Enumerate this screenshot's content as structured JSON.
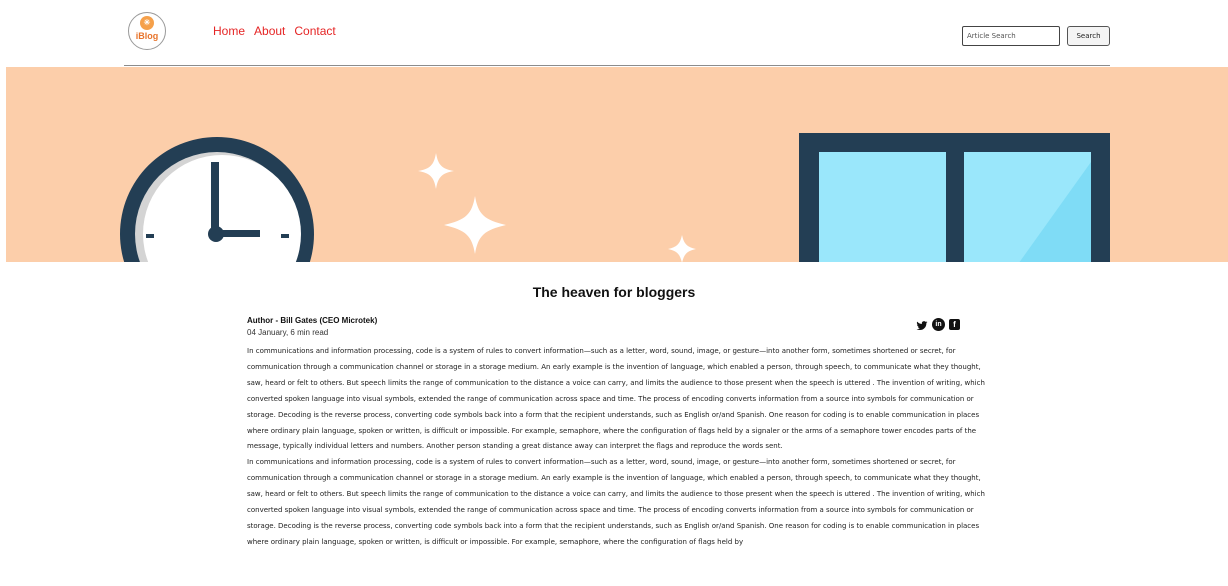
{
  "header": {
    "logo_text": "iBlog",
    "nav": [
      "Home",
      "About",
      "Contact"
    ],
    "search_placeholder": "Article Search",
    "search_button": "Search"
  },
  "hero": {
    "colors": {
      "background": "#fcceaa",
      "dark": "#233e54",
      "glass": "#9ae7fb"
    }
  },
  "article": {
    "title": "The heaven for bloggers",
    "author": "Author - Bill Gates (CEO Microtek)",
    "meta": "04 January, 6 min read",
    "social_icons": [
      "twitter-icon",
      "linkedin-icon",
      "facebook-icon"
    ],
    "paragraphs": [
      "In communications and information processing, code is a system of rules to convert information—such as a letter, word, sound, image, or gesture—into another form, sometimes shortened or secret, for communication through a communication channel or storage in a storage medium. An early example is the invention of language, which enabled a person, through speech, to communicate what they thought, saw, heard or felt to others. But speech limits the range of communication to the distance a voice can carry, and limits the audience to those present when the speech is uttered . The invention of writing, which converted spoken language into visual symbols, extended the range of communication across space and time. The process of encoding converts information from a source into symbols for communication or storage. Decoding is the reverse process, converting code symbols back into a form that the recipient understands, such as English or/and Spanish. One reason for coding is to enable communication in places where ordinary plain language, spoken or written, is difficult or impossible. For example, semaphore, where the configuration of flags held by a signaler or the arms of a semaphore tower encodes parts of the message, typically individual letters and numbers. Another person standing a great distance away can interpret the flags and reproduce the words sent.",
      "In communications and information processing, code is a system of rules to convert information—such as a letter, word, sound, image, or gesture—into another form, sometimes shortened or secret, for communication through a communication channel or storage in a storage medium. An early example is the invention of language, which enabled a person, through speech, to communicate what they thought, saw, heard or felt to others. But speech limits the range of communication to the distance a voice can carry, and limits the audience to those present when the speech is uttered . The invention of writing, which converted spoken language into visual symbols, extended the range of communication across space and time. The process of encoding converts information from a source into symbols for communication or storage. Decoding is the reverse process, converting code symbols back into a form that the recipient understands, such as English or/and Spanish. One reason for coding is to enable communication in places where ordinary plain language, spoken or written, is difficult or impossible. For example, semaphore, where the configuration of flags held by"
    ]
  }
}
